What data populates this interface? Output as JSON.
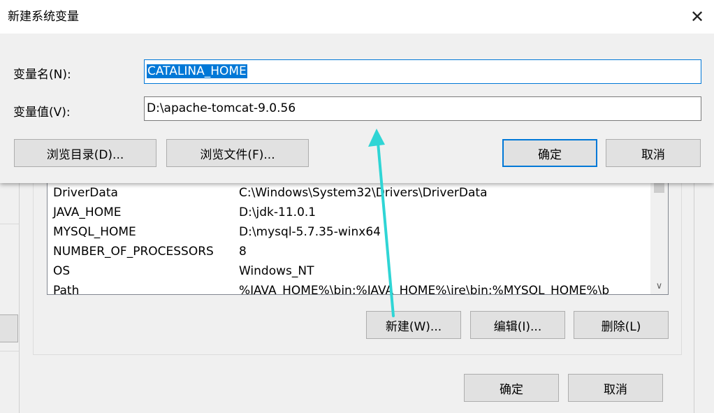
{
  "dialog": {
    "title": "新建系统变量",
    "name_label": "变量名(N):",
    "name_value": "CATALINA_HOME",
    "value_label": "变量值(V):",
    "value_value": "D:\\apache-tomcat-9.0.56",
    "browse_dir_label": "浏览目录(D)...",
    "browse_file_label": "浏览文件(F)...",
    "ok_label": "确定",
    "cancel_label": "取消",
    "close_icon": "close-icon"
  },
  "background": {
    "variables": [
      {
        "name": "DriverData",
        "value": "C:\\Windows\\System32\\Drivers\\DriverData"
      },
      {
        "name": "JAVA_HOME",
        "value": "D:\\jdk-11.0.1"
      },
      {
        "name": "MYSQL_HOME",
        "value": "D:\\mysql-5.7.35-winx64"
      },
      {
        "name": "NUMBER_OF_PROCESSORS",
        "value": "8"
      },
      {
        "name": "OS",
        "value": "Windows_NT"
      },
      {
        "name": "Path",
        "value": "%JAVA_HOME%\\bin;%JAVA_HOME%\\jre\\bin;%MYSQL_HOME%\\b"
      }
    ],
    "new_label": "新建(W)...",
    "edit_label": "编辑(I)...",
    "delete_label": "删除(L)",
    "ok_label": "确定",
    "cancel_label": "取消"
  },
  "colors": {
    "accent": "#0078d7",
    "arrow": "#2fd5d5"
  }
}
